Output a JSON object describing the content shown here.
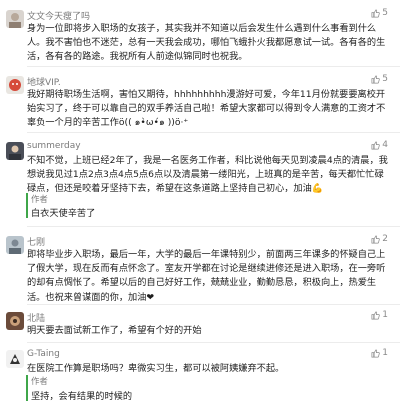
{
  "comments": [
    {
      "name": "文文今天瘦了吗",
      "likes": "5",
      "text": "身为一位即将步入职场的女孩子，其实我并不知道以后会发生什么遇到什么事看到什么人。我不害怕也不迷茫，总有一天我会成功，哪怕飞蛾扑火我都愿意试一试。各有各的生活，各有各的路途。我祝所有人前途似锦同时也祝我。"
    },
    {
      "name": "地球VIP.",
      "likes": "5",
      "text": "我好期待职场生活啊，害怕又期待，hhhhhhhhh漫游好可爱，今年11月份就要要离校开始实习了，终于可以靠自己的双手养活自己啦！希望大家都可以得到令人满意的工资才不辜负一个月的辛苦工作ö(( ๑•̀ω•́๑ ))ö‧⁺"
    },
    {
      "name": "summerday",
      "likes": "4",
      "text": "不知不觉，上班已经2年了，我是一名医务工作者，科比说他每天见到凌晨4点的清晨，我想说我见过1点2点3点4点5点6点以及清晨第一缕阳光，上班真的是辛苦，每天都忙忙碌碌点，但还是咬着牙坚持下去，希望在这条道路上坚持自己初心，加油💪",
      "reply_author": "作者",
      "reply_text": "白衣天使辛苦了"
    },
    {
      "name": "七刚",
      "likes": "2",
      "text": "即将毕业步入职场，最后一年，大学的最后一年课特别少，前面两三年课多的怀疑自己上了假大学，现在反而有点怀念了。室友开学都在讨论是继续进修还是进入职场，在一旁听的却有点惆怅了。希望以后的自己好好工作，兢兢业业，勤勤恳恳，积极向上，热爱生活。也祝来曾谋面的你，加油❤"
    },
    {
      "name": "北陆",
      "likes": "1",
      "text": "明天要去面试新工作了，希望有个好的开始"
    },
    {
      "name": "G-Taing",
      "likes": "1",
      "text": "在医院工作算是职场吗？卑微实习生，都可以被阿姨嫌弃不起。",
      "reply_author": "作者",
      "reply_text": "坚持，会有结果的时候的"
    }
  ],
  "colors": {
    "reply_bar": "#3fa64a",
    "name_text": "#7a7a7a",
    "body_text": "#1e1e1e",
    "like_icon": "#8a8a8a"
  },
  "icons": {
    "like": "thumbs-up-icon"
  }
}
